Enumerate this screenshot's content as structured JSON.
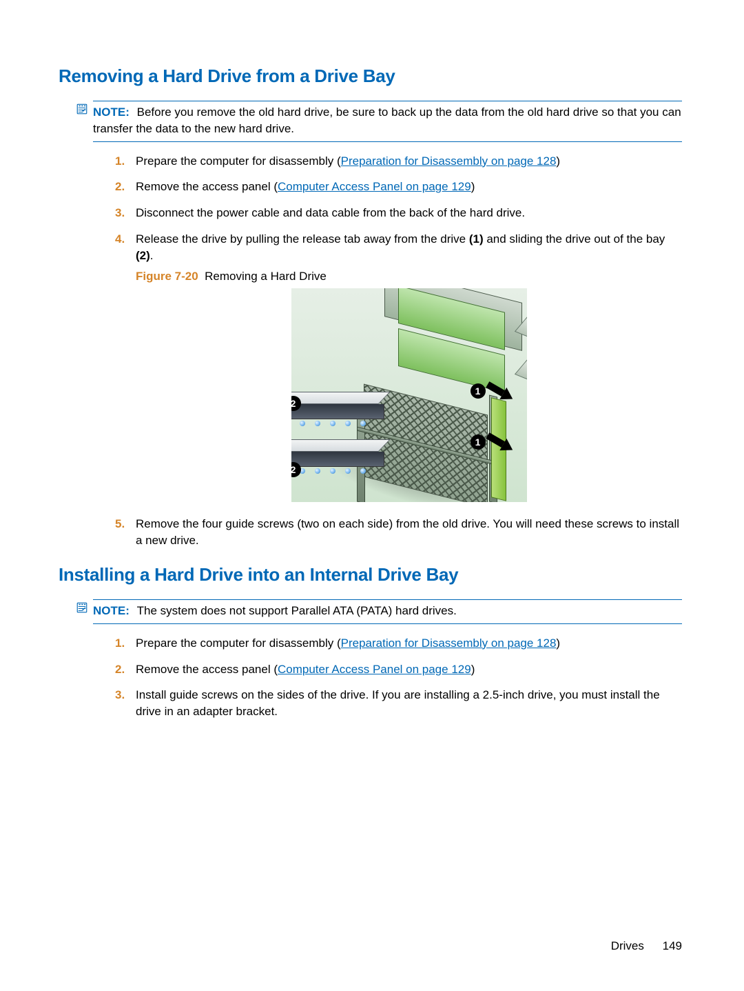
{
  "section1": {
    "heading": "Removing a Hard Drive from a Drive Bay",
    "note_label": "NOTE:",
    "note_text": "Before you remove the old hard drive, be sure to back up the data from the old hard drive so that you can transfer the data to the new hard drive.",
    "steps": [
      {
        "num": "1.",
        "pre": "Prepare the computer for disassembly (",
        "link": "Preparation for Disassembly on page 128",
        "post": ")"
      },
      {
        "num": "2.",
        "pre": "Remove the access panel (",
        "link": "Computer Access Panel on page 129",
        "post": ")"
      },
      {
        "num": "3.",
        "text": "Disconnect the power cable and data cable from the back of the hard drive."
      },
      {
        "num": "4.",
        "html_parts": [
          "Release the drive by pulling the release tab away from the drive ",
          "(1)",
          " and sliding the drive out of the bay ",
          "(2)",
          "."
        ]
      },
      {
        "num": "5.",
        "text": "Remove the four guide screws (two on each side) from the old drive. You will need these screws to install a new drive."
      }
    ],
    "figure_label": "Figure 7-20",
    "figure_title": "Removing a Hard Drive",
    "callouts": {
      "one": "1",
      "two": "2"
    }
  },
  "section2": {
    "heading": "Installing a Hard Drive into an Internal Drive Bay",
    "note_label": "NOTE:",
    "note_text": "The system does not support Parallel ATA (PATA) hard drives.",
    "steps": [
      {
        "num": "1.",
        "pre": "Prepare the computer for disassembly (",
        "link": "Preparation for Disassembly on page 128",
        "post": ")"
      },
      {
        "num": "2.",
        "pre": "Remove the access panel (",
        "link": "Computer Access Panel on page 129",
        "post": ")"
      },
      {
        "num": "3.",
        "text": "Install guide screws on the sides of the drive. If you are installing a 2.5-inch drive, you must install the drive in an adapter bracket."
      }
    ]
  },
  "footer": {
    "section": "Drives",
    "page": "149"
  }
}
